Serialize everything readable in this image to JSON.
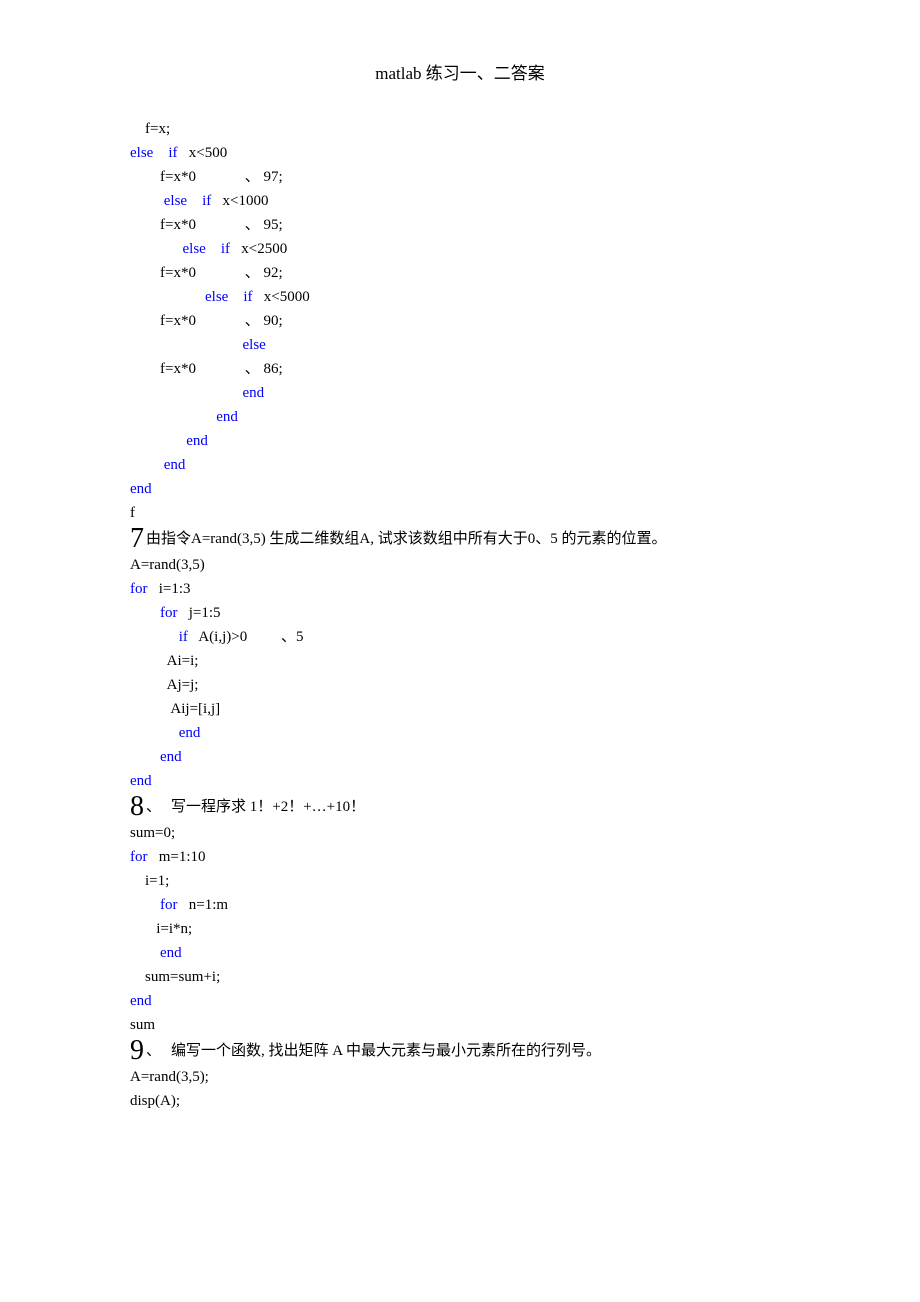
{
  "title": "matlab  练习一、二答案",
  "block_a": {
    "l1": "    f=x;",
    "l2_a": "else",
    "l2_b": "    if",
    "l2_c": "   x<500",
    "l3": "        f=x*0             、 97;",
    "l4_a": "         else",
    "l4_b": "    if",
    "l4_c": "   x<1000",
    "l5": "        f=x*0             、 95;",
    "l6_a": "              else",
    "l6_b": "    if",
    "l6_c": "   x<2500",
    "l7": "        f=x*0             、 92;",
    "l8_a": "                    else",
    "l8_b": "    if",
    "l8_c": "   x<5000",
    "l9": "        f=x*0             、 90;",
    "l10": "                              else",
    "l11": "        f=x*0             、 86;",
    "l12": "                              end",
    "l13": "                       end",
    "l14": "               end",
    "l15": "         end",
    "l16": "end",
    "l17": "f"
  },
  "q7_num": "7",
  "q7_text": "由指令A=rand(3,5) 生成二维数组A, 试求该数组中所有大于0、5  的元素的位置。",
  "block_b": {
    "l1": "A=rand(3,5)",
    "l2_a": "for",
    "l2_b": "   i=1:3",
    "l3_a": "        for",
    "l3_b": "   j=1:5",
    "l4_a": "             if",
    "l4_b": "   A(i,j)>0         、5",
    "l5": "          Ai=i;",
    "l6": "          Aj=j;",
    "l7": "           Aij=[i,j]",
    "l8": "             end",
    "l9": "        end",
    "l10": "end"
  },
  "q8_num": "8",
  "q8_sep": "、",
  "q8_text": "写一程序求 1！+2！+…+10！",
  "block_c": {
    "l1": "sum=0;",
    "l2_a": "for",
    "l2_b": "   m=1:10",
    "l3": "    i=1;",
    "l4_a": "        for",
    "l4_b": "   n=1:m",
    "l5": "       i=i*n;",
    "l6": "        end",
    "l7": "    sum=sum+i;",
    "l8": "end",
    "l9": "sum"
  },
  "q9_num": "9",
  "q9_sep": "、",
  "q9_text": "编写一个函数, 找出矩阵 A  中最大元素与最小元素所在的行列号。",
  "block_d": {
    "l1": "A=rand(3,5);",
    "l2": "disp(A);"
  }
}
